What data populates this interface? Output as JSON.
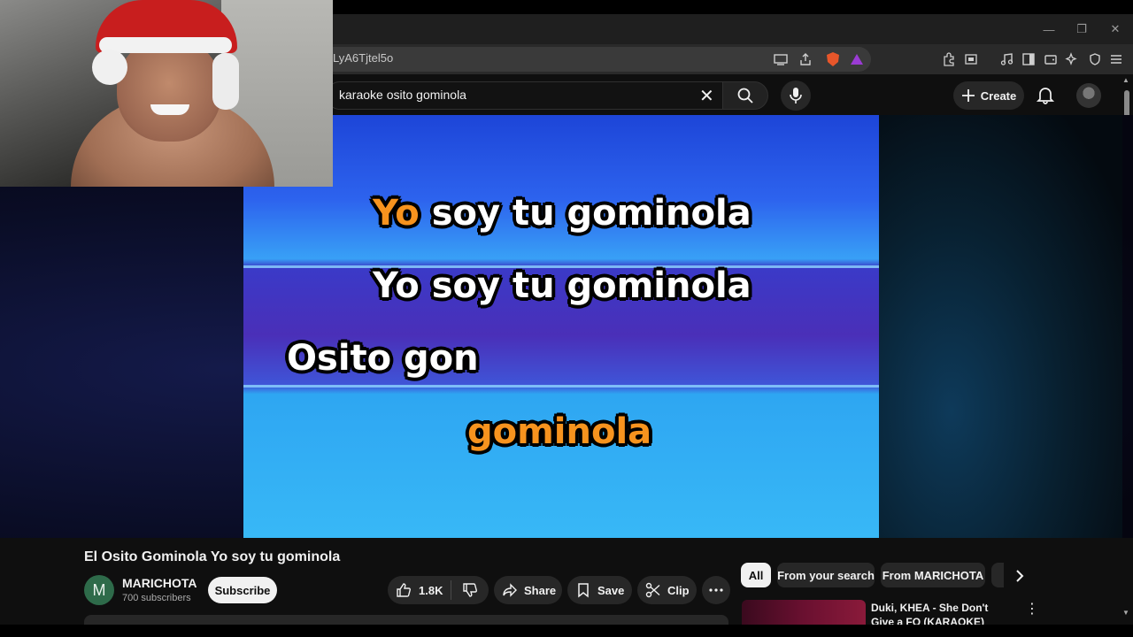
{
  "browser": {
    "url_fragment": "LyA6Tjtel5o",
    "window_controls": [
      "minimize-icon",
      "restore-icon",
      "close-icon"
    ]
  },
  "header": {
    "search_query": "karaoke osito gominola",
    "create_label": "Create"
  },
  "video": {
    "lyrics": {
      "line1_highlight": "Yo",
      "line1_rest": " soy tu gominola",
      "line2": "Yo soy tu gominola",
      "line3": "Osito gon",
      "line4": "gominola"
    },
    "title": "El Osito Gominola Yo soy tu gominola"
  },
  "channel": {
    "avatar_letter": "M",
    "name": "MARICHOTA",
    "subscribers": "700 subscribers",
    "subscribe_label": "Subscribe"
  },
  "actions": {
    "likes": "1.8K",
    "share": "Share",
    "save": "Save",
    "clip": "Clip"
  },
  "chips": [
    "All",
    "From your search",
    "From MARICHOTA"
  ],
  "recommendation": {
    "title": "Duki, KHEA - She Don't Give a FO (KARAOKE)"
  },
  "colors": {
    "highlight": "#f7931e",
    "background": "#0f0f0f",
    "chip_active": "#f1f1f1"
  }
}
